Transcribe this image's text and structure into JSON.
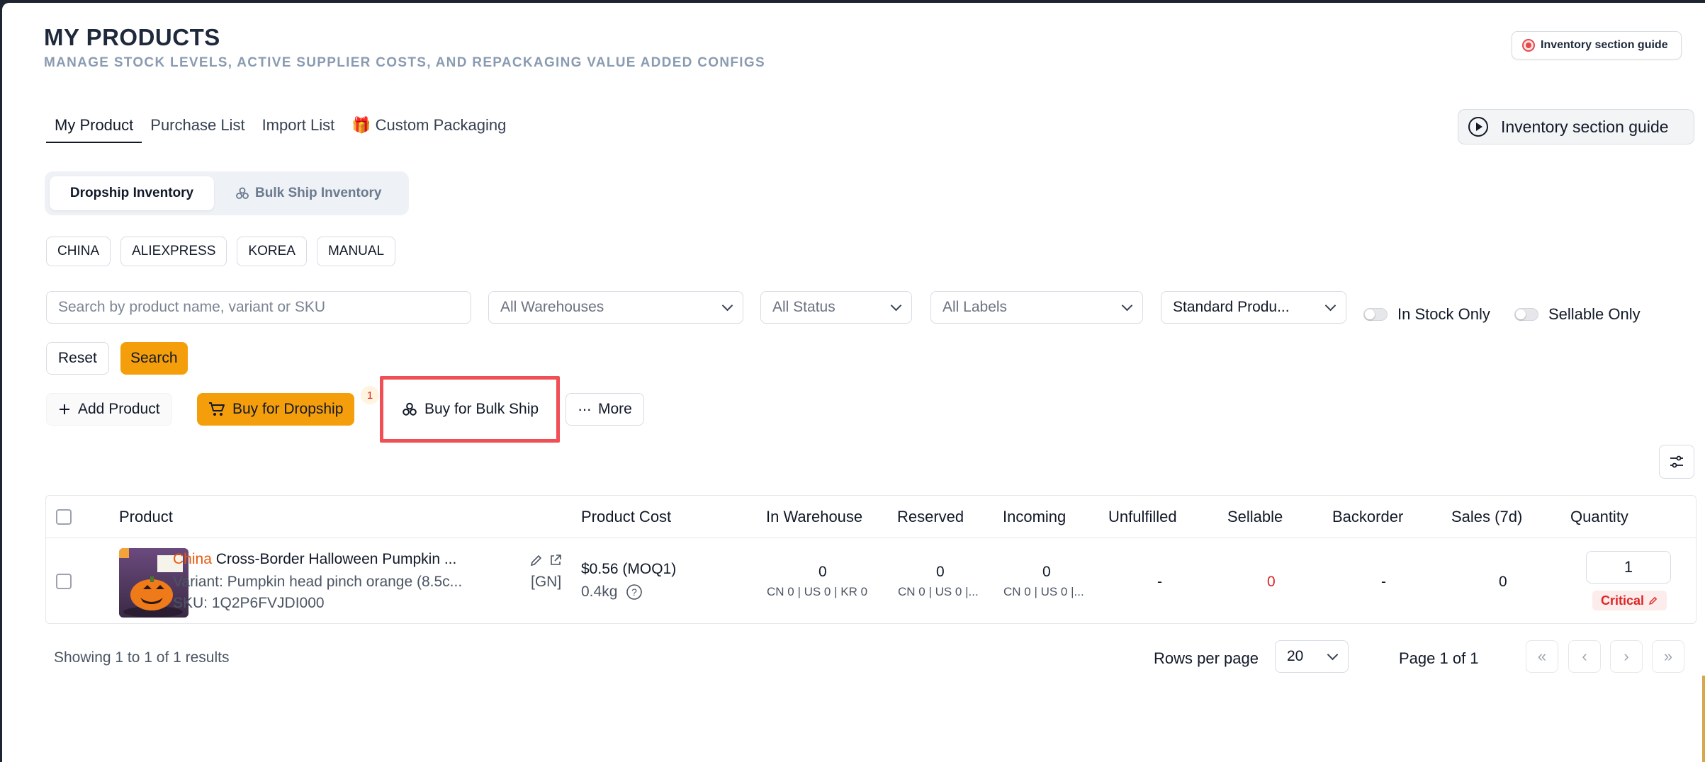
{
  "header": {
    "title": "MY PRODUCTS",
    "subtitle": "MANAGE STOCK LEVELS, ACTIVE SUPPLIER COSTS, AND REPACKAGING VALUE ADDED CONFIGS",
    "guide_small": "Inventory section guide",
    "guide_big": "Inventory section guide"
  },
  "tabs": [
    {
      "label": "My Product"
    },
    {
      "label": "Purchase List"
    },
    {
      "label": "Import List"
    },
    {
      "label": "Custom Packaging",
      "icon": "🎁"
    }
  ],
  "inventory_toggle": [
    "Dropship Inventory",
    "Bulk Ship Inventory"
  ],
  "sources": [
    "CHINA",
    "ALIEXPRESS",
    "KOREA",
    "MANUAL"
  ],
  "filters": {
    "search_placeholder": "Search by product name, variant or SKU",
    "warehouse": "All Warehouses",
    "status": "All Status",
    "labels": "All Labels",
    "product_type": "Standard Produ...",
    "in_stock_only": "In Stock Only",
    "sellable_only": "Sellable Only",
    "reset": "Reset",
    "search": "Search"
  },
  "actions": {
    "add_product": "Add Product",
    "buy_dropship": "Buy for Dropship",
    "dropship_badge": "1",
    "buy_bulk": "Buy for Bulk Ship",
    "more": "More"
  },
  "table": {
    "columns": [
      "Product",
      "Product Cost",
      "In Warehouse",
      "Reserved",
      "Incoming",
      "Unfulfilled",
      "Sellable",
      "Backorder",
      "Sales (7d)",
      "Quantity"
    ],
    "rows": [
      {
        "origin": "China",
        "name": "Cross-Border Halloween Pumpkin ...",
        "variant": "Variant: Pumpkin head pinch orange (8.5c...",
        "variant_tag": "[GN]",
        "sku": "SKU: 1Q2P6FVJDI000",
        "cost": "$0.56 (MOQ1)",
        "weight": "0.4kg",
        "in_warehouse": "0",
        "in_warehouse_sub": "CN 0 | US 0 | KR 0",
        "reserved": "0",
        "reserved_sub": "CN 0 | US 0 |...",
        "incoming": "0",
        "incoming_sub": "CN 0 | US 0 |...",
        "unfulfilled": "-",
        "sellable": "0",
        "backorder": "-",
        "sales_7d": "0",
        "quantity": "1",
        "status": "Critical"
      }
    ]
  },
  "footer": {
    "showing": "Showing 1 to 1 of 1 results",
    "rows_per_page_label": "Rows per page",
    "rows_per_page": "20",
    "page": "Page 1 of 1"
  },
  "colors": {
    "accent": "#f59e0b",
    "highlight": "#ef4f55",
    "critical": "#dc2626",
    "origin": "#ea580c"
  }
}
